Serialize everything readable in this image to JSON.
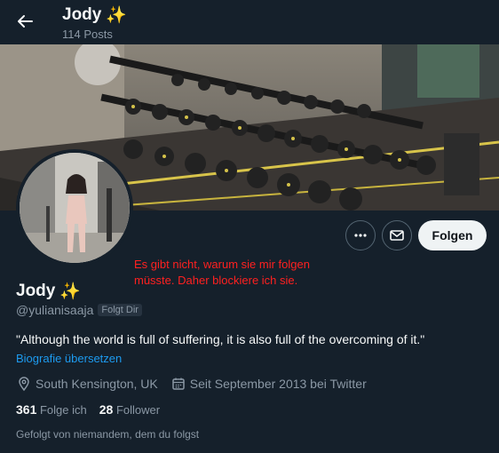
{
  "header": {
    "title": "Jody",
    "sparkle": "✨",
    "posts_count": "114 Posts"
  },
  "profile": {
    "name": "Jody",
    "sparkle": "✨",
    "handle": "@yulianisaaja",
    "follows_you_badge": "Folgt Dir",
    "bio": "\"Although the world is full of suffering, it is also full of the overcoming of it.\"",
    "translate_link": "Biografie übersetzen",
    "location": "South Kensington, UK",
    "joined": "Seit September 2013 bei Twitter",
    "following_count": "361",
    "following_label": "Folge ich",
    "followers_count": "28",
    "followers_label": "Follower",
    "followed_by_text": "Gefolgt von niemandem, dem du folgst"
  },
  "actions": {
    "follow_label": "Folgen"
  },
  "annotation": "Es gibt nicht, warum sie mir folgen müsste. Daher blockiere ich sie.",
  "colors": {
    "background": "#15202b",
    "link": "#1d9bf0",
    "annotation": "#ff2020"
  },
  "icons": [
    "back-arrow-icon",
    "more-icon",
    "mail-icon",
    "location-icon",
    "calendar-icon"
  ]
}
